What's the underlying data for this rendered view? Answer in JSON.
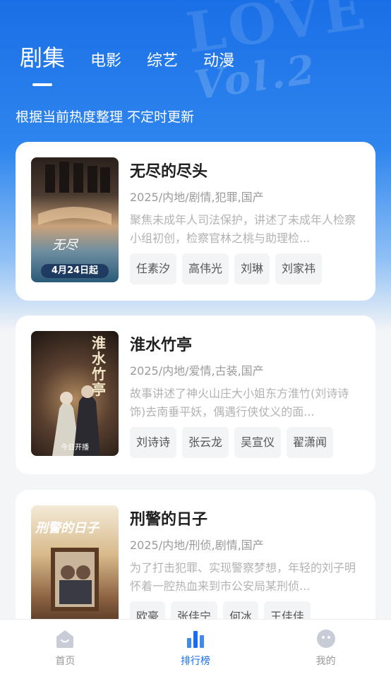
{
  "tabs": [
    {
      "label": "剧集",
      "active": true
    },
    {
      "label": "电影",
      "active": false
    },
    {
      "label": "综艺",
      "active": false
    },
    {
      "label": "动漫",
      "active": false
    }
  ],
  "subtitle": "根据当前热度整理 不定时更新",
  "items": [
    {
      "title": "无尽的尽头",
      "meta": "2025/内地/剧情,犯罪,国产",
      "desc": "聚焦未成年人司法保护，讲述了未成年人检察小组初创，检察官林之桃与助理检...",
      "tags": [
        "任素汐",
        "高伟光",
        "刘琳",
        "刘家祎"
      ],
      "poster_badge": "4月24日起",
      "poster_colors": [
        "#3a2a22",
        "#c8a27a",
        "#2f5f7a"
      ]
    },
    {
      "title": "淮水竹亭",
      "meta": "2025/内地/爱情,古装,国产",
      "desc": "故事讲述了神火山庄大小姐东方淮竹(刘诗诗 饰)去南垂平妖，偶遇行侠仗义的面...",
      "tags": [
        "刘诗诗",
        "张云龙",
        "吴宣仪",
        "翟潇闻"
      ],
      "poster_badge": "今日开播",
      "poster_title": "淮水竹亭",
      "poster_colors": [
        "#2a1e1a",
        "#8a6a4a",
        "#1b1410"
      ]
    },
    {
      "title": "刑警的日子",
      "meta": "2025/内地/刑侦,剧情,国产",
      "desc": "为了打击犯罪、实现警察梦想，年轻的刘子明怀着一腔热血来到市公安局某刑侦...",
      "tags": [
        "欧豪",
        "张佳宁",
        "何冰",
        "王佳佳"
      ],
      "poster_title": "刑警的日子",
      "poster_colors": [
        "#7a5a40",
        "#c9a06a",
        "#4a3020"
      ]
    }
  ],
  "nav": [
    {
      "label": "首页",
      "icon": "home-icon",
      "active": false
    },
    {
      "label": "排行榜",
      "icon": "ranking-icon",
      "active": true
    },
    {
      "label": "我的",
      "icon": "profile-icon",
      "active": false
    }
  ],
  "colors": {
    "accent": "#1a6fe6",
    "hero_top": "#1a6fe6"
  }
}
